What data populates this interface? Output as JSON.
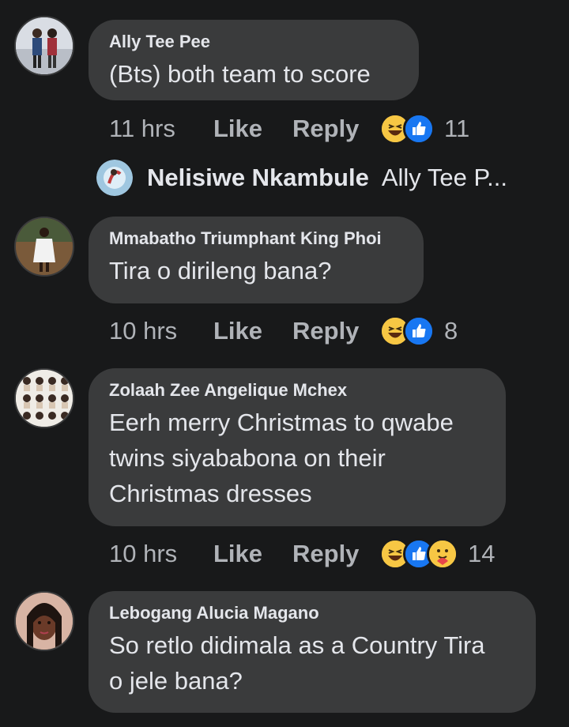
{
  "comments": [
    {
      "author": "Ally Tee Pee",
      "text_lines": [
        "(Bts) both team to score"
      ],
      "time": "11 hrs",
      "like_label": "Like",
      "reply_label": "Reply",
      "reactions": [
        "haha-icon",
        "like-icon"
      ],
      "reaction_count": "11"
    },
    {
      "author": "Mmabatho Triumphant King Phoi",
      "text_lines": [
        "Tira o dirileng bana?"
      ],
      "time": "10 hrs",
      "like_label": "Like",
      "reply_label": "Reply",
      "reactions": [
        "haha-icon",
        "like-icon"
      ],
      "reaction_count": "8"
    },
    {
      "author": "Zolaah Zee Angelique Mchex",
      "text_lines": [
        "Eerh merry Christmas to qwabe",
        "twins siyababona on their",
        "Christmas dresses"
      ],
      "time": "10 hrs",
      "like_label": "Like",
      "reply_label": "Reply",
      "reactions": [
        "haha-icon",
        "like-icon",
        "care-icon"
      ],
      "reaction_count": "14"
    },
    {
      "author": "Lebogang Alucia Magano",
      "text_lines": [
        "So retlo didimala as a Country Tira",
        "o jele bana?"
      ]
    }
  ],
  "reply_preview": {
    "author": "Nelisiwe Nkambule",
    "snippet": "Ally Tee P..."
  },
  "colors": {
    "background": "#18191a",
    "bubble": "#3a3b3c",
    "like_blue": "#1877f2",
    "haha_yellow": "#f7c744"
  }
}
